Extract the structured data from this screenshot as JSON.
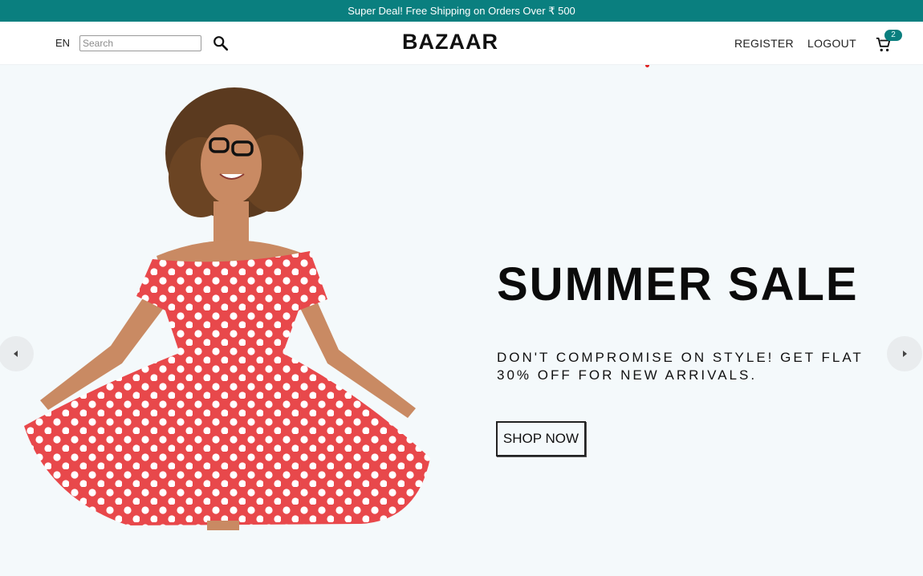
{
  "announcement": {
    "text": "Super Deal! Free Shipping on Orders Over ₹ 500"
  },
  "header": {
    "language": "EN",
    "search": {
      "placeholder": "Search",
      "value": ""
    },
    "logo": "BAZAAR",
    "nav": {
      "register": "REGISTER",
      "logout": "LOGOUT"
    },
    "cart": {
      "count": "2"
    }
  },
  "hero": {
    "title": "SUMMER SALE",
    "subtitle": "DON'T COMPROMISE ON STYLE! GET FLAT 30% OFF FOR NEW ARRIVALS.",
    "cta": "SHOP NOW",
    "image": "woman-in-red-polka-dot-dress"
  },
  "icons": {
    "search": "search-icon",
    "cart": "cart-icon",
    "prev": "chevron-left-icon",
    "next": "chevron-right-icon"
  },
  "colors": {
    "accent": "#0a7f7f",
    "hero_bg": "#f4f9fb",
    "dress": "#e8484b",
    "indicator": "#e02020"
  }
}
